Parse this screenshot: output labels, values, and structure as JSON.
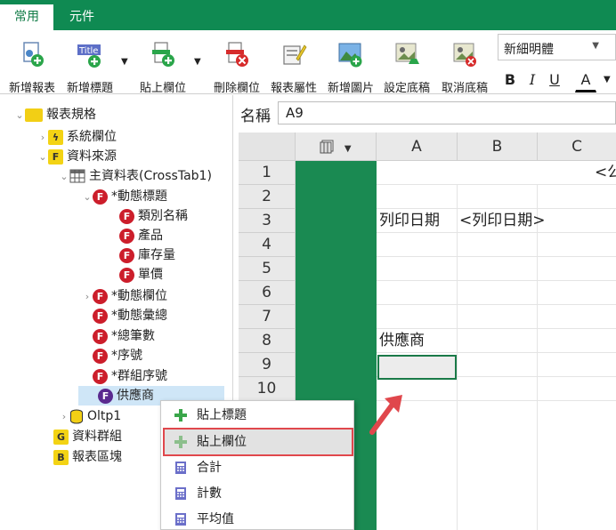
{
  "tabs": [
    "常用",
    "元件"
  ],
  "ribbon": {
    "buttons": [
      "新增報表",
      "新增標題",
      "貼上欄位",
      "刪除欄位",
      "報表屬性",
      "新增圖片",
      "設定底稿",
      "取消底稿"
    ],
    "font_name": "新細明體",
    "bold": "B",
    "italic": "I",
    "underline": "U",
    "font_color": "A"
  },
  "tree": {
    "root": "報表規格",
    "system_fields": "系統欄位",
    "datasource": "資料來源",
    "master_table": "主資料表(CrossTab1)",
    "dynamic_title": "*動態標題",
    "dyn_children": [
      "類別名稱",
      "產品",
      "庫存量",
      "單價"
    ],
    "dynamic_field": "*動態欄位",
    "dynamic_summary": "*動態彙總",
    "total_count": "*總筆數",
    "seq_no": "*序號",
    "group_seq": "*群組序號",
    "supplier": "供應商",
    "oltp": "Oltp1",
    "data_group": "資料群組",
    "report_block": "報表區塊"
  },
  "namebar": {
    "label": "名稱",
    "value": "A9"
  },
  "grid": {
    "columns": [
      "A",
      "B",
      "C"
    ],
    "rows": [
      "1",
      "2",
      "3",
      "4",
      "5",
      "6",
      "7",
      "8",
      "9",
      "10"
    ],
    "r1c": "<公",
    "r3a": "列印日期",
    "r3b": "<列印日期>",
    "r8a": "供應商"
  },
  "context_menu": [
    "貼上標題",
    "貼上欄位",
    "合計",
    "計數",
    "平均值"
  ],
  "colors": {
    "brand": "#0f8a52",
    "grid_green": "#1a8a52",
    "highlight": "#e0474c",
    "f_red": "#cc1e2b",
    "f_purple": "#5a2a8f"
  }
}
